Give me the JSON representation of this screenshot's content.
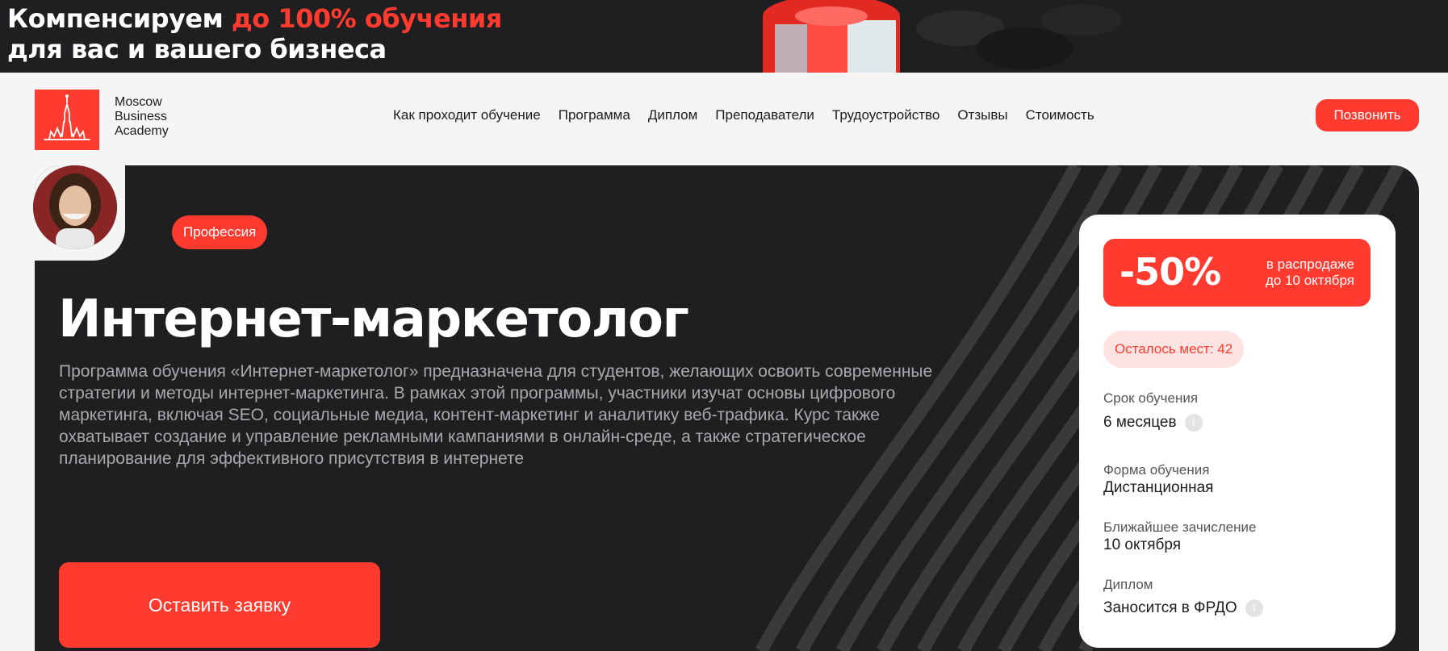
{
  "promo": {
    "line1_prefix": "Компенсируем",
    "line1_accent": "до 100% обучения",
    "line2": "для вас и вашего бизнеса"
  },
  "header": {
    "logo_lines": [
      "Moscow",
      "Business",
      "Academy"
    ],
    "nav": [
      "Как проходит обучение",
      "Программа",
      "Диплом",
      "Преподаватели",
      "Трудоустройство",
      "Отзывы",
      "Стоимость"
    ],
    "call_label": "Позвонить"
  },
  "hero": {
    "tag": "Профессия",
    "title": "Интернет-маркетолог",
    "description": "Программа обучения «Интернет-маркетолог» предназначена для студентов, желающих освоить современные стратегии и методы интернет-маркетинга. В рамках этой программы, участники изучат основы цифрового маркетинга, включая SEO, социальные медиа, контент-маркетинг и аналитику веб-трафика. Курс также охватывает создание и управление рекламными кампаниями в онлайн-среде, а также стратегическое планирование для эффективного присутствия в интернете",
    "apply_label": "Оставить заявку"
  },
  "info": {
    "sale_percent": "-50%",
    "sale_line1": "в распродаже",
    "sale_line2": "до 10 октября",
    "seats": "Осталось мест: 42",
    "fields": [
      {
        "label": "Срок обучения",
        "value": "6 месяцев"
      },
      {
        "label": "Форма обучения",
        "value": "Дистанционная"
      },
      {
        "label": "Ближайшее зачисление",
        "value": "10 октября"
      },
      {
        "label": "Диплом",
        "value": "Заносится в ФРДО"
      }
    ]
  },
  "colors": {
    "accent": "#ff3b30",
    "dark": "#1f1f21",
    "background": "#f5f5f5"
  },
  "icons": [
    "kremlin-logo-icon",
    "info-icon"
  ]
}
